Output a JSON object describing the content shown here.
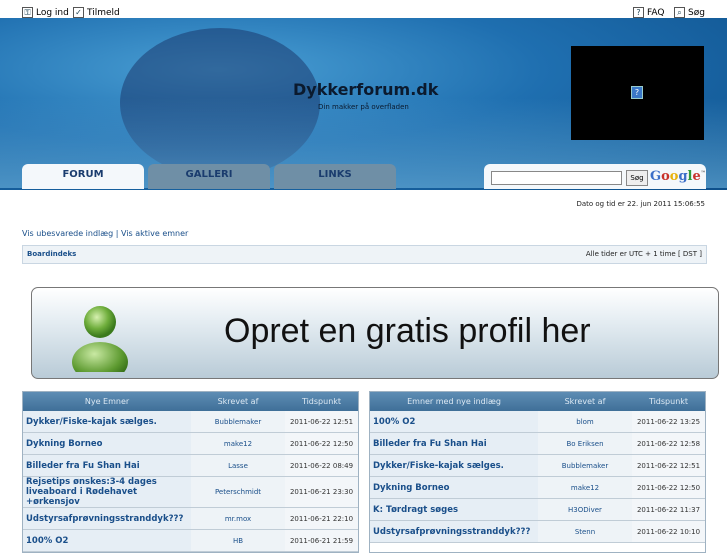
{
  "topbar": {
    "login": "Log ind",
    "register": "Tilmeld",
    "faq": "FAQ",
    "search": "Søg"
  },
  "site": {
    "title": "Dykkerforum.dk",
    "subtitle": "Din makker på overfladen"
  },
  "tabs": [
    {
      "label": "FORUM"
    },
    {
      "label": "GALLERI"
    },
    {
      "label": "LINKS"
    }
  ],
  "google_search": {
    "value": "",
    "button": "Søg",
    "logo": "Google™"
  },
  "date_text": "Dato og tid er 22. jun 2011 15:06:55",
  "links": {
    "unanswered": "Vis ubesvarede indlæg",
    "separator": "|",
    "active": "Vis aktive emner"
  },
  "breadcrumb": {
    "board": "Boardindeks",
    "timezone": "Alle tider er UTC + 1 time [ DST ]"
  },
  "banner": {
    "text": "Opret en gratis profil her"
  },
  "table_new": {
    "headers": [
      "Nye Emner",
      "Skrevet af",
      "Tidspunkt"
    ],
    "rows": [
      {
        "subject": "Dykker/Fiske-kajak sælges.",
        "author": "Bubblemaker",
        "time": "2011-06-22 12:51"
      },
      {
        "subject": "Dykning Borneo",
        "author": "make12",
        "time": "2011-06-22 12:50"
      },
      {
        "subject": "Billeder fra Fu Shan Hai",
        "author": "Lasse",
        "time": "2011-06-22 08:49"
      },
      {
        "subject": "Rejsetips ønskes:3-4 dages liveaboard i Rødehavet +ørkensjov",
        "author": "Peterschmidt",
        "time": "2011-06-21 23:30"
      },
      {
        "subject": "Udstyrsafprøvningsstranddyk???",
        "author": "mr.mox",
        "time": "2011-06-21 22:10"
      },
      {
        "subject": "100% O2",
        "author": "HB",
        "time": "2011-06-21 21:59"
      }
    ]
  },
  "table_replies": {
    "headers": [
      "Emner med nye indlæg",
      "Skrevet af",
      "Tidspunkt"
    ],
    "rows": [
      {
        "subject": "100% O2",
        "author": "blom",
        "time": "2011-06-22 13:25"
      },
      {
        "subject": "Billeder fra Fu Shan Hai",
        "author": "Bo Eriksen",
        "time": "2011-06-22 12:58"
      },
      {
        "subject": "Dykker/Fiske-kajak sælges.",
        "author": "Bubblemaker",
        "time": "2011-06-22 12:51"
      },
      {
        "subject": "Dykning Borneo",
        "author": "make12",
        "time": "2011-06-22 12:50"
      },
      {
        "subject": "K: Tørdragt søges",
        "author": "H3ODiver",
        "time": "2011-06-22 11:37"
      },
      {
        "subject": "Udstyrsafprøvningsstranddyk???",
        "author": "Stenn",
        "time": "2011-06-22 10:10"
      }
    ]
  }
}
